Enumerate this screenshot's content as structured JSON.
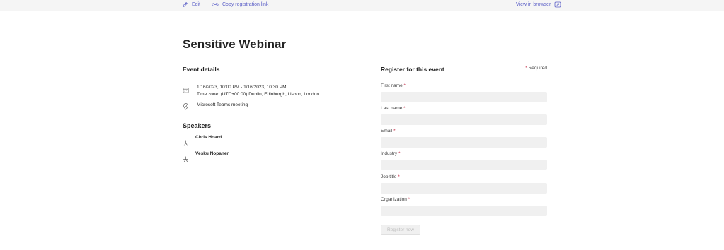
{
  "toolbar": {
    "edit_label": "Edit",
    "copy_label": "Copy registration link",
    "view_label": "View in browser"
  },
  "page": {
    "title": "Sensitive Webinar"
  },
  "event_details": {
    "heading": "Event details",
    "date_range": "1/16/2023, 10:00 PM - 1/16/2023, 10:30 PM",
    "time_zone": "Time zone: (UTC+00:00) Dublin, Edinburgh, Lisbon, London",
    "location": "Microsoft Teams meeting"
  },
  "speakers": {
    "heading": "Speakers",
    "items": [
      {
        "name": "Chris Hoard"
      },
      {
        "name": "Vesku Nopanen"
      }
    ]
  },
  "registration": {
    "heading": "Register for this event",
    "required_star": "*",
    "required_text": "Required",
    "fields": [
      {
        "label": "First name",
        "star": "*",
        "value": ""
      },
      {
        "label": "Last name",
        "star": "*",
        "value": ""
      },
      {
        "label": "Email",
        "star": "*",
        "value": ""
      },
      {
        "label": "Industry",
        "star": "*",
        "value": ""
      },
      {
        "label": "Job title",
        "star": "*",
        "value": ""
      },
      {
        "label": "Organization",
        "star": "*",
        "value": ""
      }
    ],
    "submit_label": "Register now"
  },
  "colors": {
    "accent": "#5b5fc7",
    "required": "#c4314b",
    "input_bg": "#f0f0f0",
    "topbar_bg": "#f5f5f5"
  }
}
